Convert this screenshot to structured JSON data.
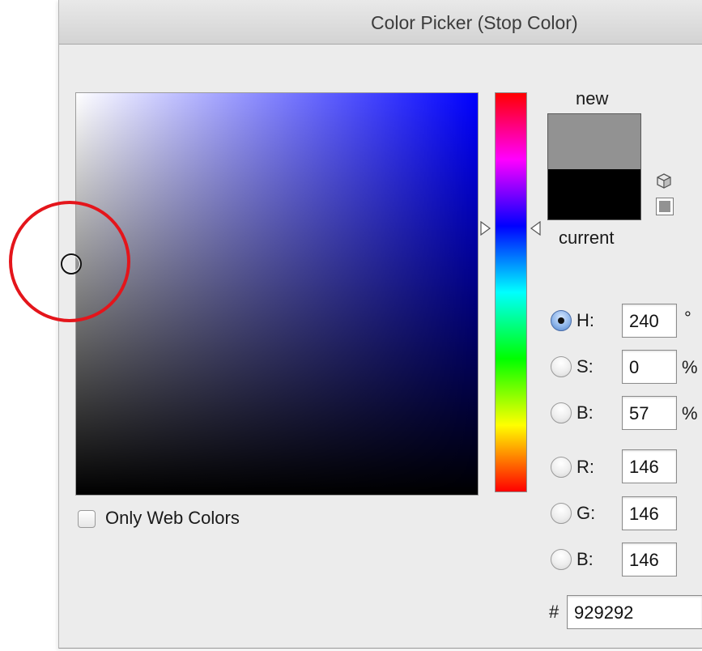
{
  "window": {
    "title": "Color Picker (Stop Color)"
  },
  "picker": {
    "hue_base_color": "#0000ff",
    "selected_color": "#929292"
  },
  "swatches": {
    "new_label": "new",
    "current_label": "current",
    "new_color": "#929292",
    "current_color": "#000000"
  },
  "fields": {
    "H": {
      "label": "H:",
      "value": "240",
      "unit": "°",
      "selected": true
    },
    "S": {
      "label": "S:",
      "value": "0",
      "unit": "%",
      "selected": false
    },
    "B": {
      "label": "B:",
      "value": "57",
      "unit": "%",
      "selected": false
    },
    "R": {
      "label": "R:",
      "value": "146",
      "selected": false
    },
    "G": {
      "label": "G:",
      "value": "146",
      "selected": false
    },
    "B_rgb": {
      "label": "B:",
      "value": "146",
      "selected": false
    }
  },
  "hex": {
    "prefix": "#",
    "value": "929292"
  },
  "web_colors": {
    "label": "Only Web Colors",
    "checked": false
  },
  "icons": {
    "gamut_warning": "cube-icon",
    "websafe_swatch": "websafe-swatch-icon"
  },
  "annotation": {
    "color": "#e4151b"
  }
}
